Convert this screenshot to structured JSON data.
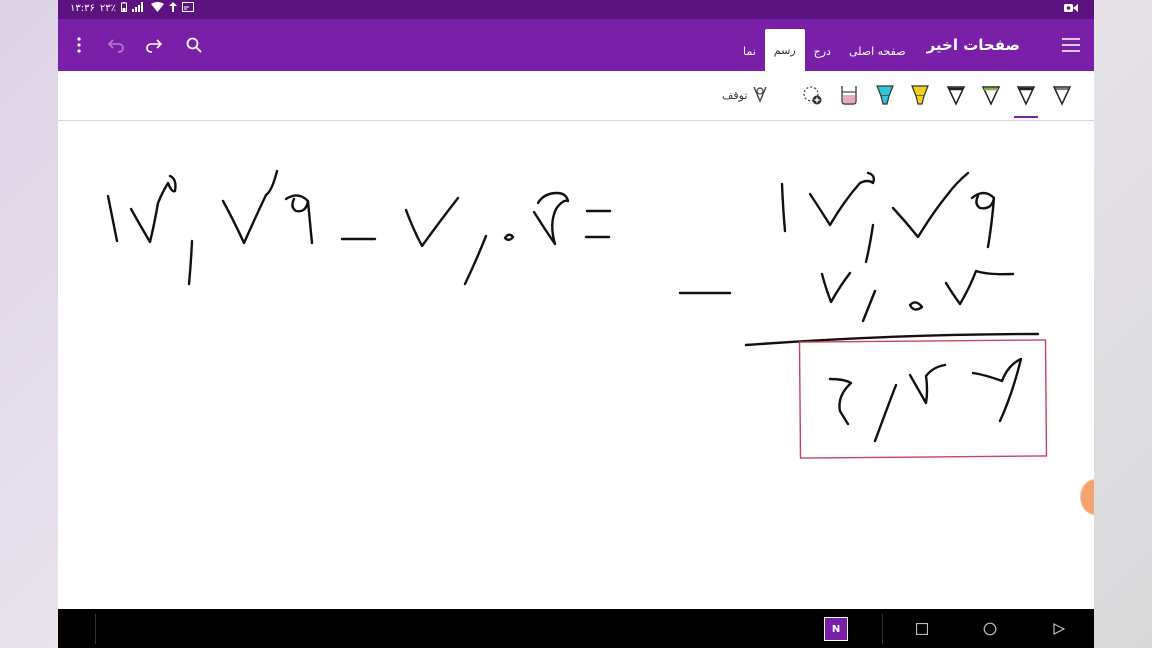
{
  "status_bar": {
    "time": "۱۳:۳۶",
    "battery_percent": "۲۳٪",
    "icons": [
      "battery-icon",
      "signal-icon",
      "wifi-icon",
      "data-icon",
      "cast-icon",
      "screen-record-icon"
    ]
  },
  "app_bar": {
    "title": "صفحات اخیر",
    "tabs": [
      {
        "label": "صفحه اصلی",
        "active": false
      },
      {
        "label": "درج",
        "active": false
      },
      {
        "label": "رسم",
        "active": true
      },
      {
        "label": "نما",
        "active": false
      }
    ],
    "icons": [
      "hamburger-menu-icon",
      "search-icon",
      "redo-icon",
      "undo-icon",
      "more-options-icon"
    ],
    "accent_color": "#7a20a8",
    "status_color": "#5c1380"
  },
  "ribbon": {
    "stop_label": "توقف",
    "tools": [
      {
        "name": "pen-black-1",
        "color": "#222222",
        "selected": false
      },
      {
        "name": "pen-black-2",
        "color": "#222222",
        "selected": true
      },
      {
        "name": "pen-green",
        "color": "#7fb03a",
        "selected": false
      },
      {
        "name": "pen-black-3",
        "color": "#222222",
        "selected": false
      },
      {
        "name": "highlighter-yellow",
        "color": "#f2d11c",
        "selected": false
      },
      {
        "name": "highlighter-cyan",
        "color": "#2fc7d8",
        "selected": false
      },
      {
        "name": "highlighter-pink",
        "color": "#e6a9c8",
        "selected": false
      }
    ]
  },
  "nav_bar": {
    "app_badge": "N"
  }
}
